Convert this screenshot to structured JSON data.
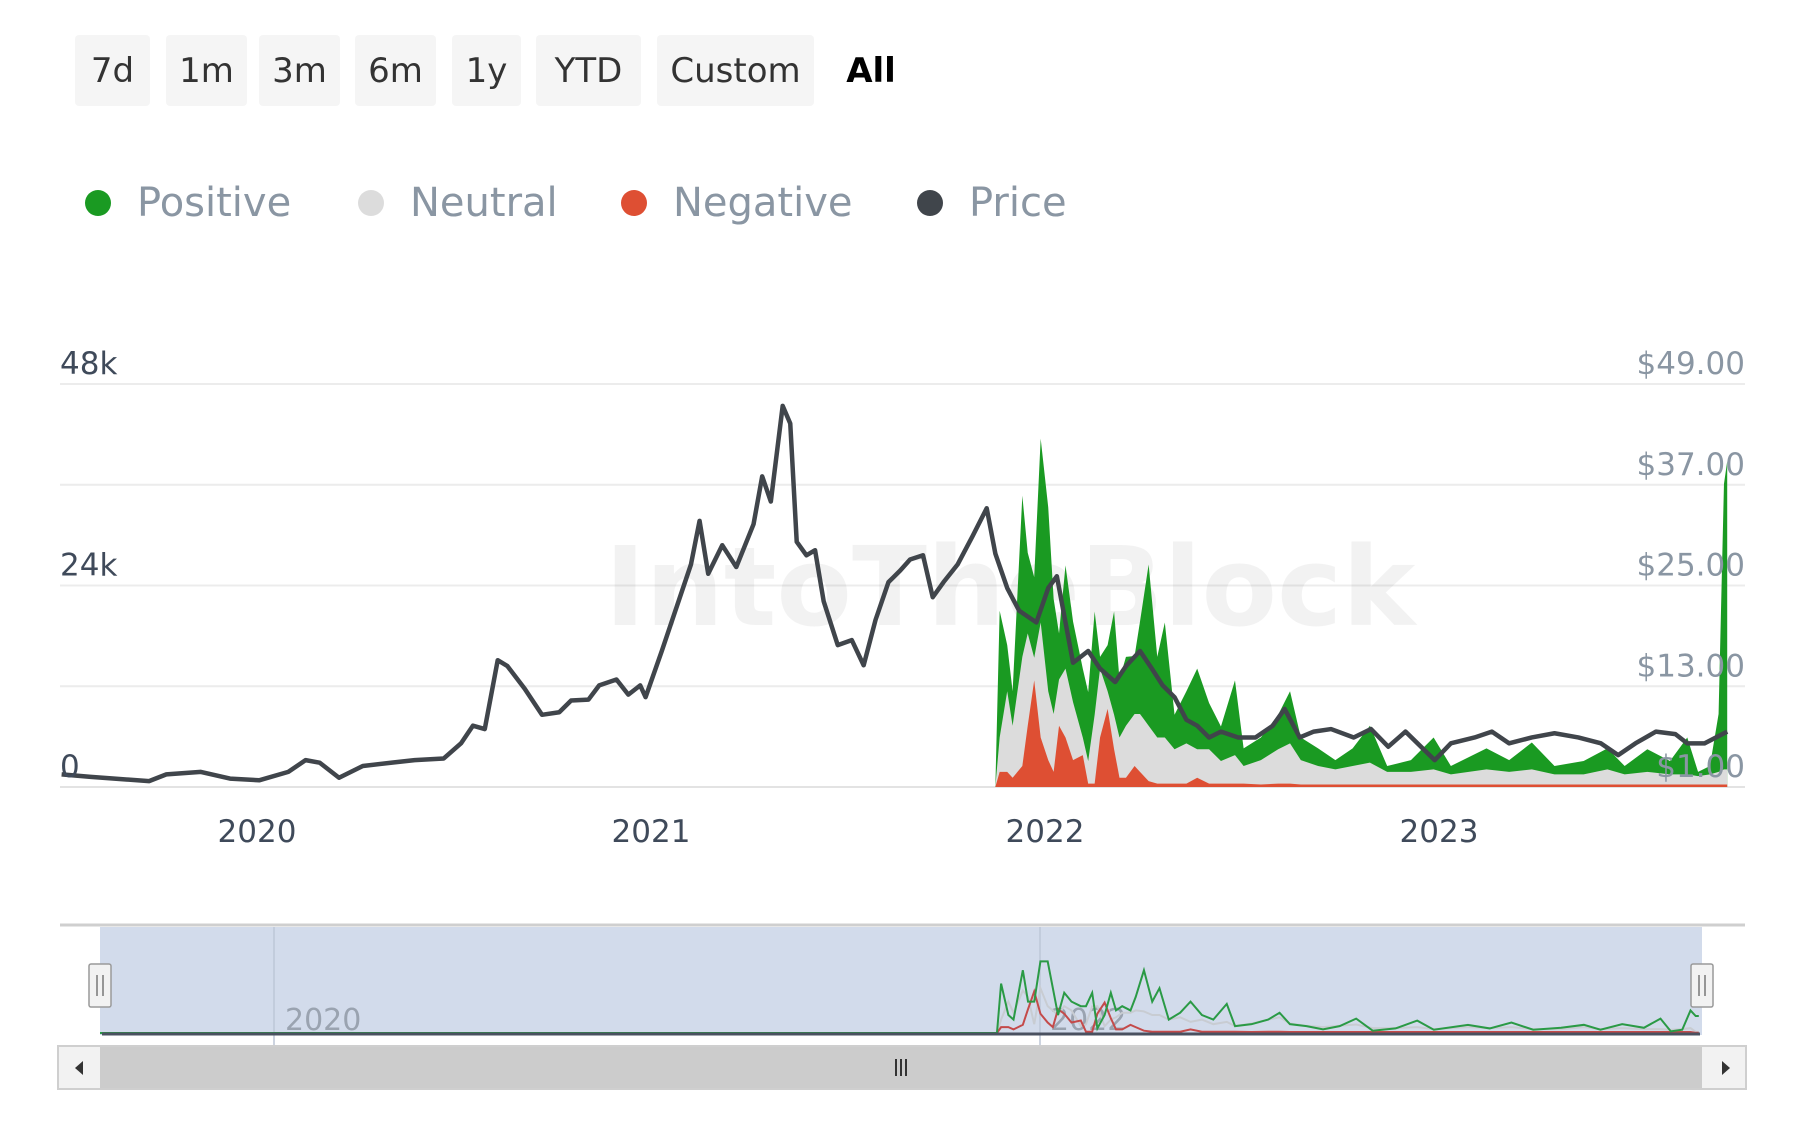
{
  "range_selector": {
    "buttons": [
      "7d",
      "1m",
      "3m",
      "6m",
      "1y",
      "YTD",
      "Custom",
      "All"
    ],
    "selected": "All"
  },
  "watermark": "IntoTheBlock",
  "legend": [
    {
      "label": "Positive",
      "color": "#1a9a22"
    },
    {
      "label": "Neutral",
      "color": "#dcdcdc"
    },
    {
      "label": "Negative",
      "color": "#de4f33"
    },
    {
      "label": "Price",
      "color": "#40454b"
    }
  ],
  "navigator": {
    "labels": [
      "2020",
      "2022"
    ],
    "handle_icon": "grip-icon",
    "scroll_left_icon": "arrow-left-icon",
    "scroll_right_icon": "arrow-right-icon",
    "scroll_thumb_icon": "grip-icon"
  },
  "chart_data": {
    "type": "area",
    "stacking": "normal",
    "grid": true,
    "legend_position": "top-left",
    "x_ticks": [
      "2020",
      "2021",
      "2022",
      "2023"
    ],
    "y_left": {
      "ticks": [
        "0",
        "24k",
        "48k"
      ],
      "range": [
        0,
        48000
      ]
    },
    "y_right": {
      "ticks": [
        "$1.00",
        "$13.00",
        "$25.00",
        "$37.00",
        "$49.00"
      ],
      "range": [
        1,
        49
      ]
    },
    "sentiment": {
      "dates": [
        "2021-11-16",
        "2021-11-20",
        "2021-11-27",
        "2021-12-02",
        "2021-12-11",
        "2021-12-16",
        "2021-12-22",
        "2021-12-28",
        "2022-01-04",
        "2022-01-09",
        "2022-01-14",
        "2022-01-20",
        "2022-01-27",
        "2022-02-05",
        "2022-02-10",
        "2022-02-16",
        "2022-02-21",
        "2022-02-28",
        "2022-03-06",
        "2022-03-11",
        "2022-03-17",
        "2022-03-25",
        "2022-03-30",
        "2022-04-07",
        "2022-04-15",
        "2022-04-22",
        "2022-05-01",
        "2022-05-12",
        "2022-05-22",
        "2022-06-02",
        "2022-06-13",
        "2022-06-26",
        "2022-07-04",
        "2022-07-20",
        "2022-08-05",
        "2022-08-16",
        "2022-08-26",
        "2022-09-11",
        "2022-09-27",
        "2022-10-13",
        "2022-10-29",
        "2022-11-14",
        "2022-12-06",
        "2022-12-27",
        "2023-01-12",
        "2023-02-14",
        "2023-03-07",
        "2023-03-28",
        "2023-04-18",
        "2023-05-15",
        "2023-06-06",
        "2023-06-22",
        "2023-07-13",
        "2023-08-03",
        "2023-08-19",
        "2023-08-29",
        "2023-09-09",
        "2023-09-17",
        "2023-09-22",
        "2023-09-25"
      ],
      "series": [
        {
          "name": "Negative",
          "values": [
            0,
            1800,
            1800,
            1100,
            2500,
            7300,
            12700,
            5900,
            3200,
            1800,
            7300,
            5900,
            3200,
            3800,
            400,
            400,
            5900,
            9300,
            4500,
            1100,
            1100,
            2500,
            1800,
            700,
            400,
            400,
            400,
            400,
            1100,
            400,
            400,
            400,
            400,
            300,
            400,
            400,
            300,
            300,
            300,
            300,
            300,
            300,
            300,
            300,
            300,
            300,
            300,
            300,
            300,
            300,
            300,
            300,
            300,
            300,
            300,
            300,
            300,
            300,
            300,
            300
          ]
        },
        {
          "name": "Neutral",
          "values": [
            0,
            4100,
            9600,
            6200,
            13000,
            11000,
            2700,
            13700,
            8200,
            6900,
            5500,
            8200,
            6900,
            2100,
            2700,
            8200,
            8200,
            2100,
            4100,
            4800,
            6200,
            6200,
            6900,
            6600,
            5500,
            5500,
            4100,
            4800,
            3400,
            4100,
            2700,
            3400,
            2100,
            2900,
            4100,
            4800,
            2900,
            2200,
            1800,
            2200,
            2600,
            1500,
            1500,
            1800,
            1200,
            1800,
            1500,
            1800,
            1200,
            1200,
            1800,
            1200,
            1500,
            1200,
            1200,
            1000,
            1200,
            1500,
            1800,
            1800
          ]
        },
        {
          "name": "Positive",
          "values": [
            0,
            15100,
            5500,
            4100,
            19200,
            9600,
            9600,
            21900,
            21900,
            13700,
            5500,
            12300,
            9600,
            8200,
            8200,
            12300,
            1400,
            5500,
            12300,
            6900,
            8200,
            6900,
            11000,
            19200,
            9600,
            13700,
            4100,
            6200,
            9600,
            5500,
            4100,
            8900,
            2100,
            2700,
            4100,
            6200,
            2700,
            2100,
            1100,
            2100,
            4400,
            700,
            1400,
            3800,
            1000,
            2500,
            1400,
            3200,
            1000,
            1600,
            2500,
            1000,
            2700,
            1600,
            4400,
            500,
            1000,
            6900,
            34000,
            36700
          ]
        }
      ]
    },
    "price": {
      "name": "Price",
      "dates": [
        "2019-07-04",
        "2019-07-31",
        "2019-08-22",
        "2019-09-23",
        "2019-10-09",
        "2019-11-10",
        "2019-12-07",
        "2020-01-03",
        "2020-01-30",
        "2020-02-15",
        "2020-02-28",
        "2020-03-17",
        "2020-04-08",
        "2020-05-05",
        "2020-05-26",
        "2020-06-22",
        "2020-07-08",
        "2020-07-19",
        "2020-07-30",
        "2020-08-11",
        "2020-08-20",
        "2020-09-05",
        "2020-09-21",
        "2020-10-07",
        "2020-10-18",
        "2020-11-03",
        "2020-11-13",
        "2020-11-29",
        "2020-12-10",
        "2020-12-21",
        "2020-12-26",
        "2021-01-11",
        "2021-01-27",
        "2021-02-07",
        "2021-02-15",
        "2021-02-23",
        "2021-03-08",
        "2021-03-21",
        "2021-04-06",
        "2021-04-14",
        "2021-04-22",
        "2021-05-03",
        "2021-05-10",
        "2021-05-16",
        "2021-05-25",
        "2021-06-02",
        "2021-06-10",
        "2021-06-23",
        "2021-07-06",
        "2021-07-17",
        "2021-07-28",
        "2021-08-09",
        "2021-08-20",
        "2021-08-29",
        "2021-09-10",
        "2021-09-19",
        "2021-09-29",
        "2021-10-12",
        "2021-10-26",
        "2021-11-08",
        "2021-11-16",
        "2021-11-27",
        "2021-12-08",
        "2021-12-24",
        "2022-01-04",
        "2022-01-12",
        "2022-01-20",
        "2022-01-27",
        "2022-02-10",
        "2022-02-21",
        "2022-03-07",
        "2022-03-17",
        "2022-03-30",
        "2022-04-10",
        "2022-04-20",
        "2022-05-01",
        "2022-05-12",
        "2022-05-22",
        "2022-06-02",
        "2022-06-13",
        "2022-06-29",
        "2022-07-15",
        "2022-07-31",
        "2022-08-11",
        "2022-08-25",
        "2022-09-07",
        "2022-09-23",
        "2022-10-14",
        "2022-10-30",
        "2022-11-15",
        "2022-12-01",
        "2022-12-28",
        "2023-01-12",
        "2023-02-03",
        "2023-02-19",
        "2023-03-07",
        "2023-03-28",
        "2023-04-18",
        "2023-05-10",
        "2023-05-31",
        "2023-06-16",
        "2023-07-02",
        "2023-07-21",
        "2023-08-08",
        "2023-08-19",
        "2023-09-04",
        "2023-09-25"
      ],
      "values": [
        2.5,
        2.2,
        2.0,
        1.7,
        2.5,
        2.8,
        2.0,
        1.8,
        2.8,
        4.2,
        3.9,
        2.1,
        3.5,
        3.9,
        4.2,
        4.4,
        6.2,
        8.3,
        7.9,
        16.1,
        15.4,
        12.7,
        9.6,
        9.9,
        11.3,
        11.4,
        13.1,
        13.8,
        12.0,
        13.1,
        11.7,
        17.2,
        23.3,
        27.5,
        32.7,
        26.4,
        29.8,
        27.2,
        32.3,
        38.0,
        35.0,
        46.4,
        44.3,
        30.2,
        28.6,
        29.2,
        23.1,
        17.9,
        18.5,
        15.5,
        20.9,
        25.4,
        26.8,
        28.1,
        28.6,
        23.6,
        25.4,
        27.5,
        30.9,
        34.2,
        28.8,
        24.7,
        22.0,
        20.6,
        24.7,
        26.1,
        20.6,
        15.8,
        17.2,
        15.1,
        13.5,
        15.4,
        17.2,
        15.1,
        13.1,
        11.7,
        9.0,
        8.3,
        6.9,
        7.6,
        6.9,
        6.9,
        8.3,
        10.3,
        6.9,
        7.6,
        7.9,
        6.9,
        7.9,
        5.8,
        7.6,
        4.2,
        6.2,
        6.9,
        7.6,
        6.2,
        6.9,
        7.4,
        6.9,
        6.2,
        4.8,
        6.2,
        7.6,
        7.3,
        6.2,
        6.2,
        7.6
      ]
    }
  }
}
